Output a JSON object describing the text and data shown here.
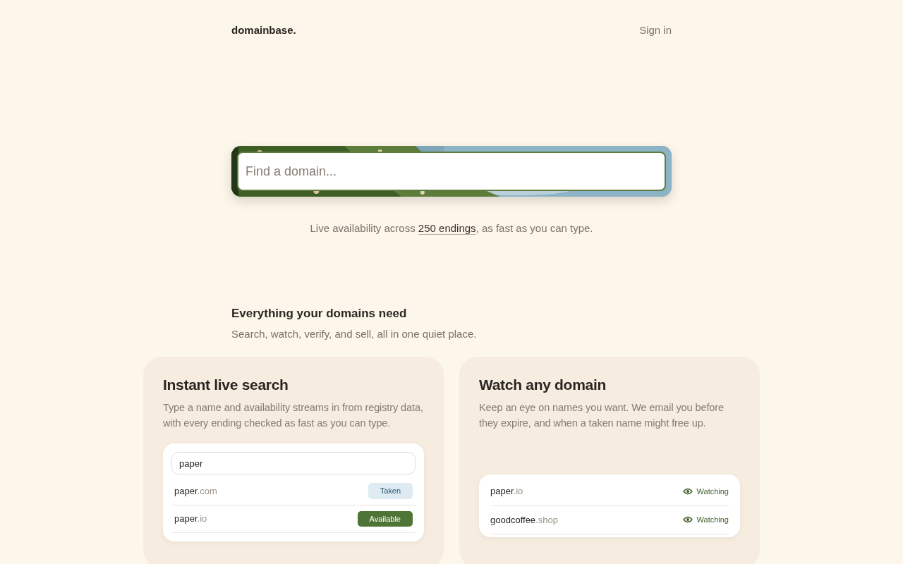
{
  "header": {
    "logo": "domainbase.",
    "sign_in": "Sign in"
  },
  "hero": {
    "search": {
      "placeholder": "Find a domain..."
    },
    "caption": {
      "before": "Live availability across ",
      "link": "250 endings",
      "after": ", as fast as you can type."
    }
  },
  "features": {
    "title": "Everything your domains need",
    "subtitle": "Search, watch, verify, and sell, all in one quiet place.",
    "cards": [
      {
        "kind": "search",
        "title": "Instant live search",
        "text": "Type a name and availability streams in from registry data, with every ending checked as fast as you can type.",
        "query": "paper",
        "rows": [
          {
            "name": "paper",
            "ending": ".com",
            "status": "Taken",
            "kind": "taken"
          },
          {
            "name": "paper",
            "ending": ".io",
            "status": "Available",
            "kind": "available"
          }
        ]
      },
      {
        "kind": "watch",
        "title": "Watch any domain",
        "text": "Keep an eye on names you want. We email you before they expire, and when a taken name might free up.",
        "rows": [
          {
            "name": "paper",
            "ending": ".io",
            "status": "Watching"
          },
          {
            "name": "goodcoffee",
            "ending": ".shop",
            "status": "Watching"
          }
        ]
      }
    ]
  }
}
